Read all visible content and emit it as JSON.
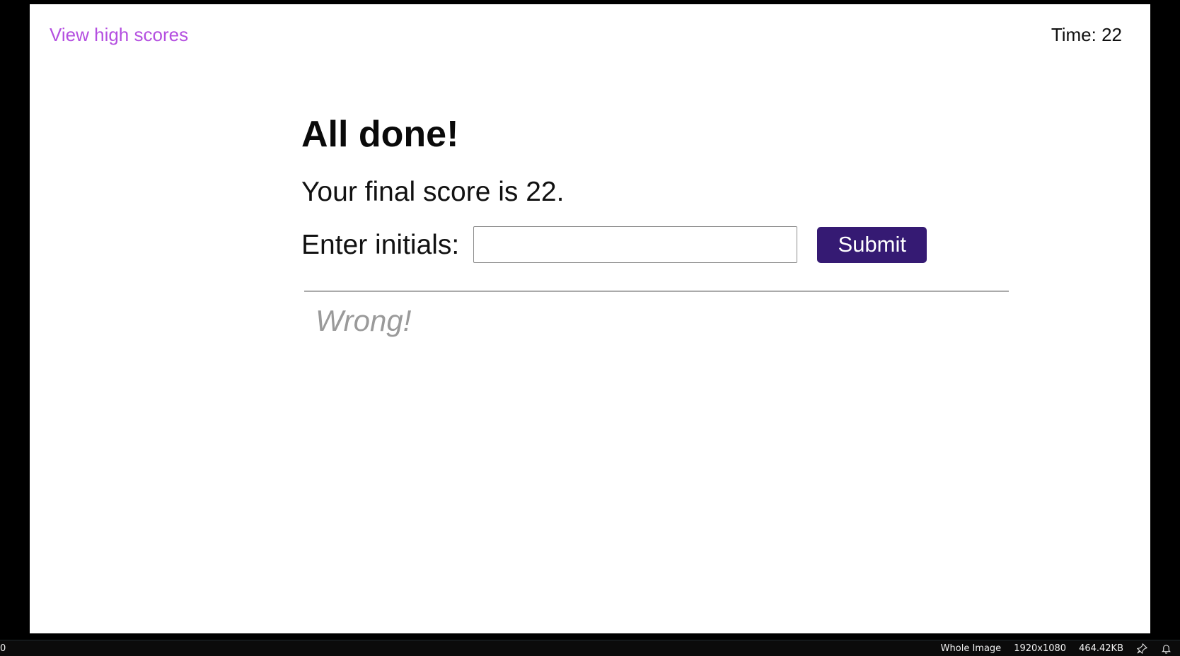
{
  "header": {
    "high_scores_link": "View high scores",
    "timer": "Time: 22"
  },
  "main": {
    "title": "All done!",
    "score_text": "Your final score is 22.",
    "initials_label": "Enter initials:",
    "initials_value": "",
    "submit_label": "Submit",
    "feedback": "Wrong!"
  },
  "status_bar": {
    "left_text": "0",
    "view_mode": "Whole Image",
    "dimensions": "1920x1080",
    "file_size": "464.42KB",
    "icons": [
      "pin-icon",
      "bell-icon"
    ]
  },
  "colors": {
    "link": "#b44fe0",
    "button": "#351a73",
    "feedback": "#9a9a9a"
  }
}
